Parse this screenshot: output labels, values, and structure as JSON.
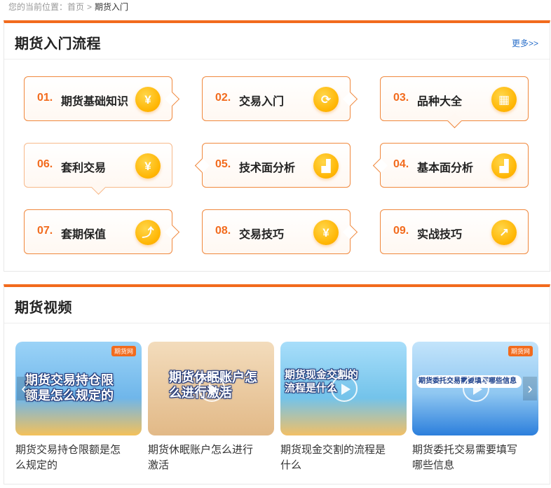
{
  "breadcrumb": {
    "prefix": "您的当前位置：",
    "home": "首页",
    "sep": ">",
    "current": "期货入门"
  },
  "flow": {
    "title": "期货入门流程",
    "more": "更多>>",
    "steps": [
      {
        "num": "01.",
        "label": "期货基础知识",
        "icon": "yen-coin-icon",
        "glyph": "¥"
      },
      {
        "num": "02.",
        "label": "交易入门",
        "icon": "refresh-icon",
        "glyph": "⟳"
      },
      {
        "num": "03.",
        "label": "品种大全",
        "icon": "calculator-icon",
        "glyph": "▦"
      },
      {
        "num": "06.",
        "label": "套利交易",
        "icon": "yen-card-icon",
        "glyph": "¥"
      },
      {
        "num": "05.",
        "label": "技术面分析",
        "icon": "bar-chart-icon",
        "glyph": "▟"
      },
      {
        "num": "04.",
        "label": "基本面分析",
        "icon": "bar-chart-icon",
        "glyph": "▟"
      },
      {
        "num": "07.",
        "label": "套期保值",
        "icon": "trend-chart-icon",
        "glyph": "⤴"
      },
      {
        "num": "08.",
        "label": "交易技巧",
        "icon": "money-bag-icon",
        "glyph": "¥"
      },
      {
        "num": "09.",
        "label": "实战技巧",
        "icon": "trend-circle-icon",
        "glyph": "↗"
      }
    ]
  },
  "video": {
    "title": "期货视频",
    "logo": "期货网",
    "items": [
      {
        "thumb_text": "期货交易持仓限额是怎么规定的",
        "title": "期货交易持仓限额是怎么规定的",
        "bg": "#7ec3f2"
      },
      {
        "thumb_text": "期货休眠账户怎么进行激活",
        "title": "期货休眠账户怎么进行激活",
        "bg": "#e7c9a0"
      },
      {
        "thumb_text": "期货现金交割的流程是什么",
        "title": "期货现金交割的流程是什么",
        "bg": "#8fd0ef"
      },
      {
        "thumb_text": "期货委托交易需要填写哪些信息",
        "title": "期货委托交易需要填写哪些信息",
        "bg": "#a9d7f7"
      }
    ]
  }
}
